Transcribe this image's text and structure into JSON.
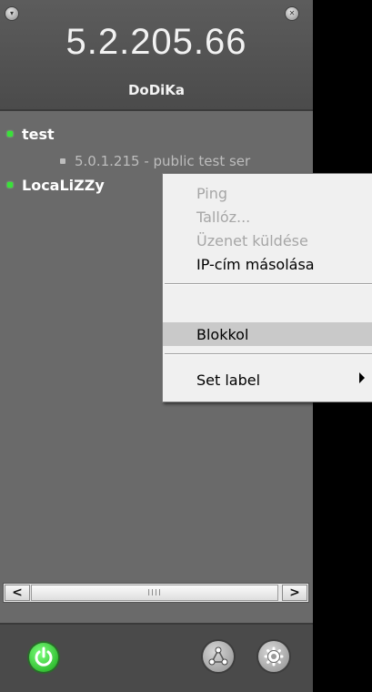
{
  "header": {
    "ip": "5.2.205.66",
    "username": "DoDiKa"
  },
  "list": {
    "items": [
      {
        "name": "test",
        "status": "online"
      },
      {
        "detail": "5.0.1.215 - public test ser"
      },
      {
        "name": "LocaLiZZy",
        "status": "online"
      }
    ]
  },
  "scrollbar": {
    "left_arrow": "<",
    "right_arrow": ">",
    "thumb_grip": "IIII"
  },
  "context_menu": {
    "items": [
      {
        "label": "Ping",
        "enabled": false
      },
      {
        "label": "Tallóz...",
        "enabled": false
      },
      {
        "label": "Üzenet küldése",
        "enabled": false
      },
      {
        "label": "IP-cím másolása",
        "enabled": true
      },
      {
        "label": "Blokkol",
        "enabled": true,
        "highlighted": true
      },
      {
        "label": "Set label",
        "enabled": true,
        "submenu": true
      }
    ]
  },
  "footer": {
    "icons": [
      "power-icon",
      "network-icon",
      "settings-icon"
    ]
  },
  "colors": {
    "online_dot": "#38e238",
    "panel_bg": "#6a6a6a",
    "menu_bg": "#f0f0f0"
  }
}
